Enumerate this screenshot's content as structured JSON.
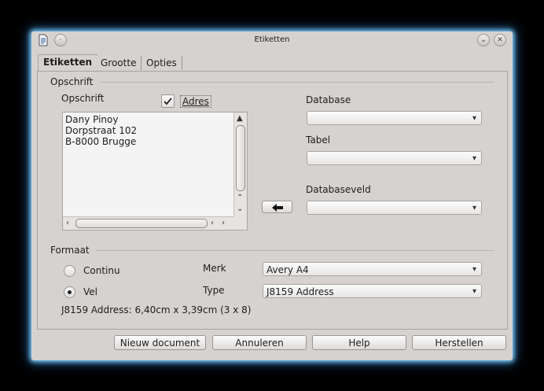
{
  "window": {
    "title": "Etiketten"
  },
  "tabs": [
    {
      "label": "Etiketten"
    },
    {
      "label": "Grootte"
    },
    {
      "label": "Opties"
    }
  ],
  "opschrift_group": {
    "title": "Opschrift",
    "field_label": "Opschrift",
    "address_checkbox": {
      "label": "Adres",
      "checked": true
    },
    "text_lines": "Dany Pinoy\nDorpstraat 102\nB-8000 Brugge",
    "database_label": "Database",
    "database_value": "",
    "tabel_label": "Tabel",
    "tabel_value": "",
    "databaseveld_label": "Databaseveld",
    "databaseveld_value": ""
  },
  "format_group": {
    "title": "Formaat",
    "radio_continu": "Continu",
    "radio_vel": "Vel",
    "selected": "Vel",
    "merk_label": "Merk",
    "merk_value": "Avery A4",
    "type_label": "Type",
    "type_value": "J8159 Address",
    "info": "J8159 Address: 6,40cm x 3,39cm (3 x 8)"
  },
  "buttons": {
    "new_doc": "Nieuw document",
    "cancel": "Annuleren",
    "help": "Help",
    "reset": "Herstellen"
  }
}
